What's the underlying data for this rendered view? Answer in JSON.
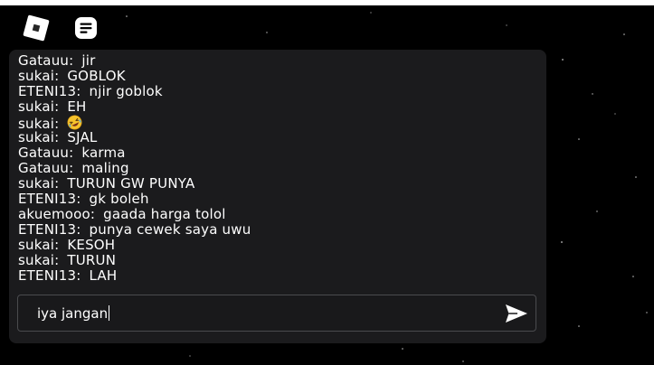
{
  "toolbar": {
    "roblox_icon": "roblox-logo-icon",
    "chat_icon": "chat-bubble-icon"
  },
  "chat": {
    "messages": [
      {
        "speaker": "Gatauu:",
        "text": "jir"
      },
      {
        "speaker": "sukai:",
        "text": "GOBLOK"
      },
      {
        "speaker": "ETENI13:",
        "text": "njir goblok"
      },
      {
        "speaker": "sukai:",
        "text": "EH"
      },
      {
        "speaker": "sukai:",
        "text": "",
        "emoji": "rolling-on-floor-laughing-emoji"
      },
      {
        "speaker": "sukai:",
        "text": "SJAL"
      },
      {
        "speaker": "Gatauu:",
        "text": "karma"
      },
      {
        "speaker": "Gatauu:",
        "text": "maling"
      },
      {
        "speaker": "sukai:",
        "text": "TURUN GW PUNYA"
      },
      {
        "speaker": "ETENI13:",
        "text": "gk boleh"
      },
      {
        "speaker": "akuemooo:",
        "text": "gaada harga tolol"
      },
      {
        "speaker": "ETENI13:",
        "text": "punya cewek saya uwu"
      },
      {
        "speaker": "sukai:",
        "text": "KESOH"
      },
      {
        "speaker": "sukai:",
        "text": "TURUN"
      },
      {
        "speaker": "ETENI13:",
        "text": "LAH"
      }
    ],
    "input_value": "iya jangan",
    "send_icon": "send-icon"
  },
  "colors": {
    "background": "#000000",
    "chat_panel": "#1b1b1d",
    "input_border": "#4a4b4e",
    "text": "#ffffff"
  }
}
